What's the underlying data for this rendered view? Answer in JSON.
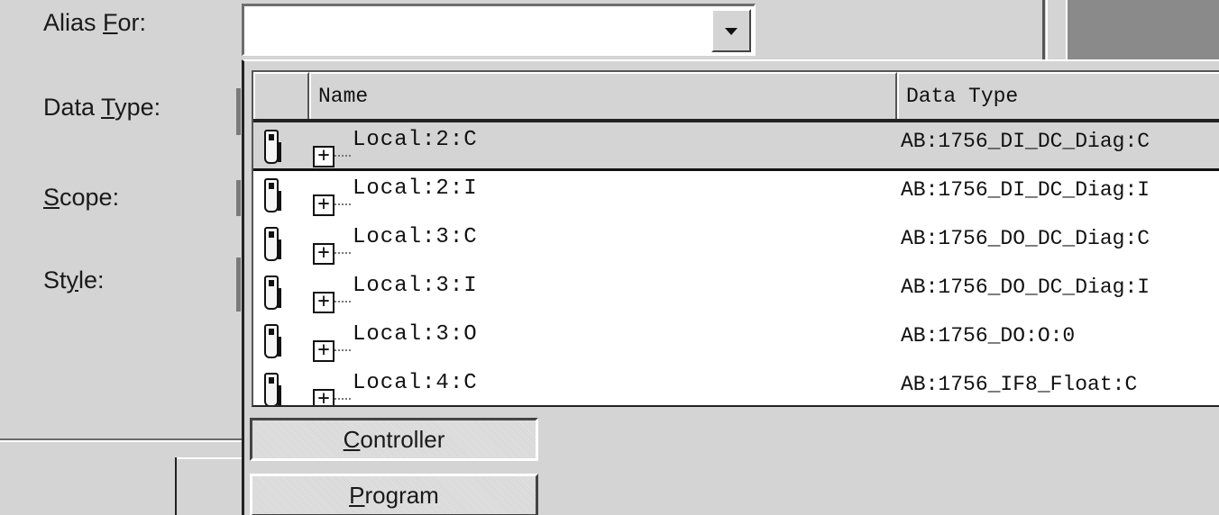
{
  "form": {
    "alias_for": {
      "prefix": "Alias ",
      "accel": "F",
      "suffix": "or:"
    },
    "data_type": {
      "prefix": "Data ",
      "accel": "T",
      "suffix": "ype:"
    },
    "scope": {
      "prefix": "",
      "accel": "S",
      "suffix": "cope:"
    },
    "style": {
      "prefix": "St",
      "accel": "y",
      "suffix": "le:"
    },
    "alias_value": ""
  },
  "popup": {
    "columns": {
      "name": "Name",
      "data_type": "Data Type"
    },
    "rows": [
      {
        "name": "Local:2:C",
        "data_type": "AB:1756_DI_DC_Diag:C",
        "selected": true
      },
      {
        "name": "Local:2:I",
        "data_type": "AB:1756_DI_DC_Diag:I",
        "selected": false
      },
      {
        "name": "Local:3:C",
        "data_type": "AB:1756_DO_DC_Diag:C",
        "selected": false
      },
      {
        "name": "Local:3:I",
        "data_type": "AB:1756_DO_DC_Diag:I",
        "selected": false
      },
      {
        "name": "Local:3:O",
        "data_type": "AB:1756_DO:O:0",
        "selected": false
      },
      {
        "name": "Local:4:C",
        "data_type": "AB:1756_IF8_Float:C",
        "selected": false
      }
    ],
    "expander_glyph": "+",
    "scope_buttons": {
      "controller": {
        "accel": "C",
        "rest": "ontroller",
        "pressed": true
      },
      "program": {
        "accel": "P",
        "rest": "rogram",
        "pressed": false
      }
    }
  },
  "icons": {
    "row_icon": "tag-icon",
    "expander": "plus-box-icon",
    "dropdown": "chevron-down-icon"
  },
  "colors": {
    "background": "#d4d4d4",
    "list_background": "#ffffff",
    "selected_row": "#d4d4d4"
  }
}
